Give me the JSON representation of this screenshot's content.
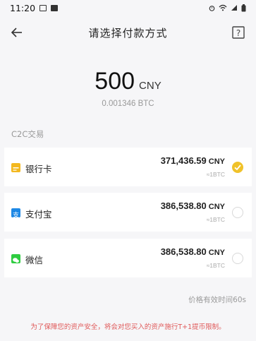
{
  "status_bar": {
    "time": "11:20"
  },
  "nav": {
    "title": "请选择付款方式",
    "back_icon": "arrow-left-icon",
    "help_icon": "question-mark-icon"
  },
  "amount": {
    "value": "500",
    "unit": "CNY",
    "btc_equiv": "0.001346 BTC"
  },
  "section_label": "C2C交易",
  "methods": [
    {
      "name": "银行卡",
      "price": "371,436.59",
      "unit": "CNY",
      "per": "≈1BTC",
      "icon": "bank-card-icon",
      "icon_color": "#f3b81f",
      "selected": true
    },
    {
      "name": "支付宝",
      "price": "386,538.80",
      "unit": "CNY",
      "per": "≈1BTC",
      "icon": "alipay-icon",
      "icon_color": "#1e88e5",
      "selected": false
    },
    {
      "name": "微信",
      "price": "386,538.80",
      "unit": "CNY",
      "per": "≈1BTC",
      "icon": "wechat-icon",
      "icon_color": "#2ecc40",
      "selected": false
    }
  ],
  "validity": "价格有效时间60s",
  "notice": "为了保障您的资产安全，将会对您买入的资产施行T+1提币限制。",
  "colors": {
    "accent": "#f0c22a",
    "notice": "#e05a5a",
    "background": "#f6f6f8"
  }
}
